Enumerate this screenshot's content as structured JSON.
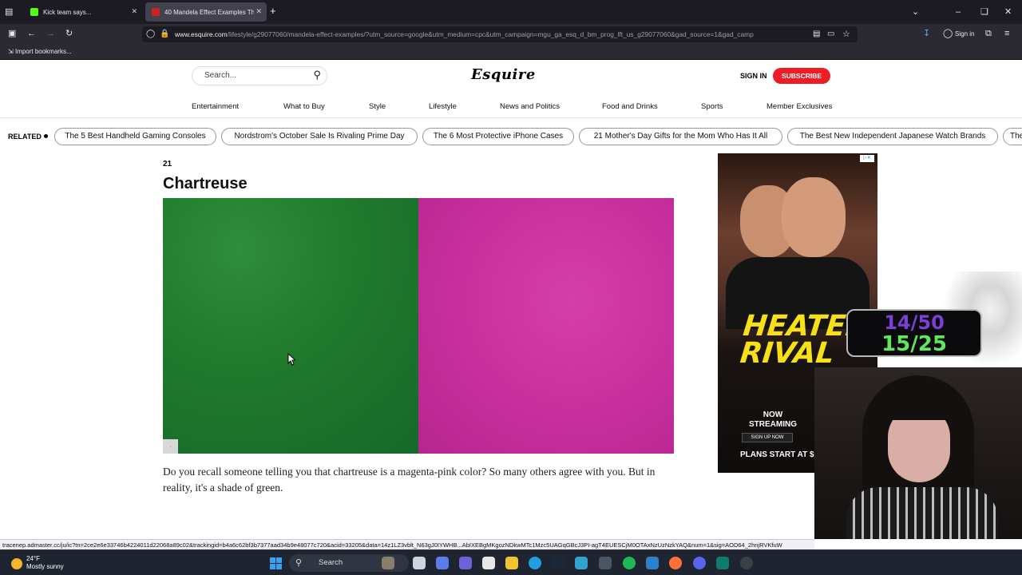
{
  "browser": {
    "tabs": [
      {
        "label": "Kick team says...",
        "active": false
      },
      {
        "label": "40 Mandela Effect Examples Th",
        "active": true
      }
    ],
    "url_host": "www.esquire.com",
    "url_path": "/lifestyle/g29077060/mandela-effect-examples/?utm_source=google&utm_medium=cpc&utm_campaign=mgu_ga_esq_d_bm_prog_lft_us_g29077060&gad_source=1&gad_camp",
    "sign_in_label": "Sign in",
    "bookmark_label": "Import bookmarks..."
  },
  "site": {
    "search_placeholder": "Search...",
    "logo": "Esquire",
    "sign_in": "SIGN IN",
    "subscribe": "SUBSCRIBE",
    "nav": [
      "Entertainment",
      "What to Buy",
      "Style",
      "Lifestyle",
      "News and Politics",
      "Food and Drinks",
      "Sports",
      "Member Exclusives"
    ],
    "related_label": "RELATED",
    "related": [
      "The 5 Best Handheld Gaming Consoles",
      "Nordstrom's October Sale Is Rivaling Prime Day",
      "The 6 Most Protective iPhone Cases",
      "21 Mother's Day Gifts for the Mom Who Has It All",
      "The Best New Independent Japanese Watch Brands",
      "The"
    ]
  },
  "article": {
    "slide_number": "21",
    "slide_title": "Chartreuse",
    "image_corner": ".",
    "caption": "Do you recall someone telling you that chartreuse is a magenta-pink color? So many others agree with you. But in reality, it's a shade of green."
  },
  "ad": {
    "title_line1": "HEATED",
    "title_line2": "RIVAL",
    "now_streaming": "NOW STREAMING",
    "sign_up": "SIGN UP NOW",
    "plans": "PLANS START AT $",
    "adchoice": "▷✕"
  },
  "overlay": {
    "counter_top": "14/50",
    "counter_bottom": "15/25"
  },
  "status_url": "tracenep.admaster.cc/ju/ic?tn=2ce2e6e33746b4224011d22068a89c02&trackingid=b4a6c62bf3b7377aad34b9e48077c720&acid=33205&data=14z1LZ3vblt_N63gJ0IYWHB...AbIXEBgMKgozNDkwMTc1Mzc5UAGqGBcJ3PI-agT4EUESCjM0OTAxNzUzNzkYAQ&num=1&sig=AOD64_2hnjRVKfuW",
  "taskbar": {
    "temperature": "24°F",
    "condition": "Mostly sunny",
    "search_label": "Search"
  }
}
